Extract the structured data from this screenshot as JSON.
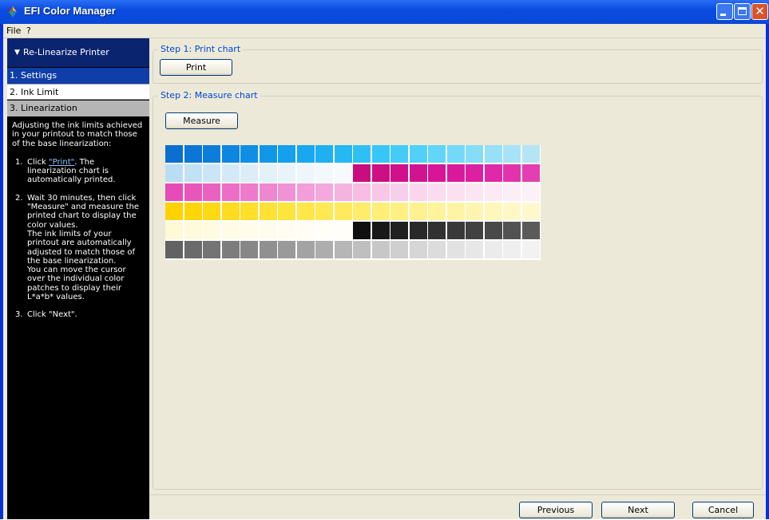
{
  "window": {
    "title": "EFI Color Manager",
    "app_icon": "efi-color-icon",
    "controls": [
      "minimize-icon",
      "maximize-icon",
      "close-icon"
    ],
    "close_glyph": "✕"
  },
  "menu": {
    "file": "File",
    "help": "?"
  },
  "sidebar": {
    "header": "Re-Linearize Printer",
    "header_icon": "triangle-down-icon",
    "items": [
      {
        "label": "1. Settings",
        "state": "selected"
      },
      {
        "label": "2. Ink Limit",
        "state": "normal"
      },
      {
        "label": "3. Linearization",
        "state": "current"
      }
    ],
    "intro": "Adjusting the ink limits achieved in your printout to match those of the base linearization:",
    "steps": [
      {
        "num": "1.",
        "pre": "Click ",
        "link": "\"Print\"",
        "post": ". The linearization chart is automatically printed."
      },
      {
        "num": "2.",
        "text": "Wait 30 minutes, then click \"Measure\" and measure the printed chart to display the color values.",
        "text2": "The ink limits of your printout are automatically adjusted to match those of the base linearization.",
        "text3": "You can move the cursor over the individual color patches to display their L*a*b* values."
      },
      {
        "num": "3.",
        "text": "Click \"Next\"."
      }
    ]
  },
  "step1": {
    "legend": "Step 1: Print chart",
    "button": "Print"
  },
  "step2": {
    "legend": "Step 2: Measure chart",
    "button": "Measure",
    "patch_rows": [
      [
        "#0a6fd0",
        "#0b76d5",
        "#0c7ddb",
        "#0d86e0",
        "#0f8fe4",
        "#1197e8",
        "#14a0ec",
        "#19a8ef",
        "#1fb0f1",
        "#26b8f3",
        "#2ec0f5",
        "#38c6f6",
        "#44ccf7",
        "#52d1f8",
        "#62d5f8",
        "#74d9f8",
        "#86ddf8",
        "#97e0f7",
        "#a7e3f6",
        "#b5e5f5"
      ],
      [
        "#b8ddf4",
        "#c1e1f5",
        "#cae5f6",
        "#d3e9f7",
        "#dcedf8",
        "#e3f1f9",
        "#e9f3fa",
        "#eef6fb",
        "#f3f8fc",
        "#f7fafd",
        "#c80e7d",
        "#cc0f84",
        "#cf118a",
        "#d21390",
        "#d61696",
        "#d91a9c",
        "#dc20a2",
        "#df29a8",
        "#e233ad",
        "#e43eb2"
      ],
      [
        "#e64bb8",
        "#e856bc",
        "#ea62c1",
        "#ec6ec6",
        "#ee7acb",
        "#f086cf",
        "#f192d4",
        "#f39ed8",
        "#f4a9dc",
        "#f6b3e0",
        "#f7bde3",
        "#f8c6e7",
        "#f9ceea",
        "#fad5ed",
        "#fadbef",
        "#fbe0f1",
        "#fbe5f3",
        "#fce9f4",
        "#fcedf6",
        "#fdf0f7"
      ],
      [
        "#ffd200",
        "#ffd60a",
        "#ffd914",
        "#ffdc1e",
        "#ffdf29",
        "#ffe233",
        "#ffe43e",
        "#ffe649",
        "#ffe854",
        "#ffea5f",
        "#ffec6b",
        "#ffee77",
        "#fff083",
        "#fff18f",
        "#fff39b",
        "#fff4a6",
        "#fff5b1",
        "#fff6bb",
        "#fff7c4",
        "#fff8cd"
      ],
      [
        "#fff9d4",
        "#fffadb",
        "#fffbe1",
        "#fffbe6",
        "#fffcea",
        "#fffcee",
        "#fffdf1",
        "#fffdf4",
        "#fffef7",
        "#fffef9",
        "#101010",
        "#181818",
        "#202020",
        "#292929",
        "#313131",
        "#393939",
        "#414141",
        "#494949",
        "#525252",
        "#5a5a5a"
      ],
      [
        "#626262",
        "#6b6b6b",
        "#747474",
        "#7d7d7d",
        "#878787",
        "#909090",
        "#9a9a9a",
        "#a3a3a3",
        "#adadad",
        "#b6b6b6",
        "#bfbfbf",
        "#c7c7c7",
        "#cfcfcf",
        "#d6d6d6",
        "#dcdcdc",
        "#e2e2e2",
        "#e7e7e7",
        "#ebebeb",
        "#efefef",
        "#f2f2f2"
      ]
    ]
  },
  "footer": {
    "previous": "Previous",
    "next": "Next",
    "cancel": "Cancel"
  }
}
